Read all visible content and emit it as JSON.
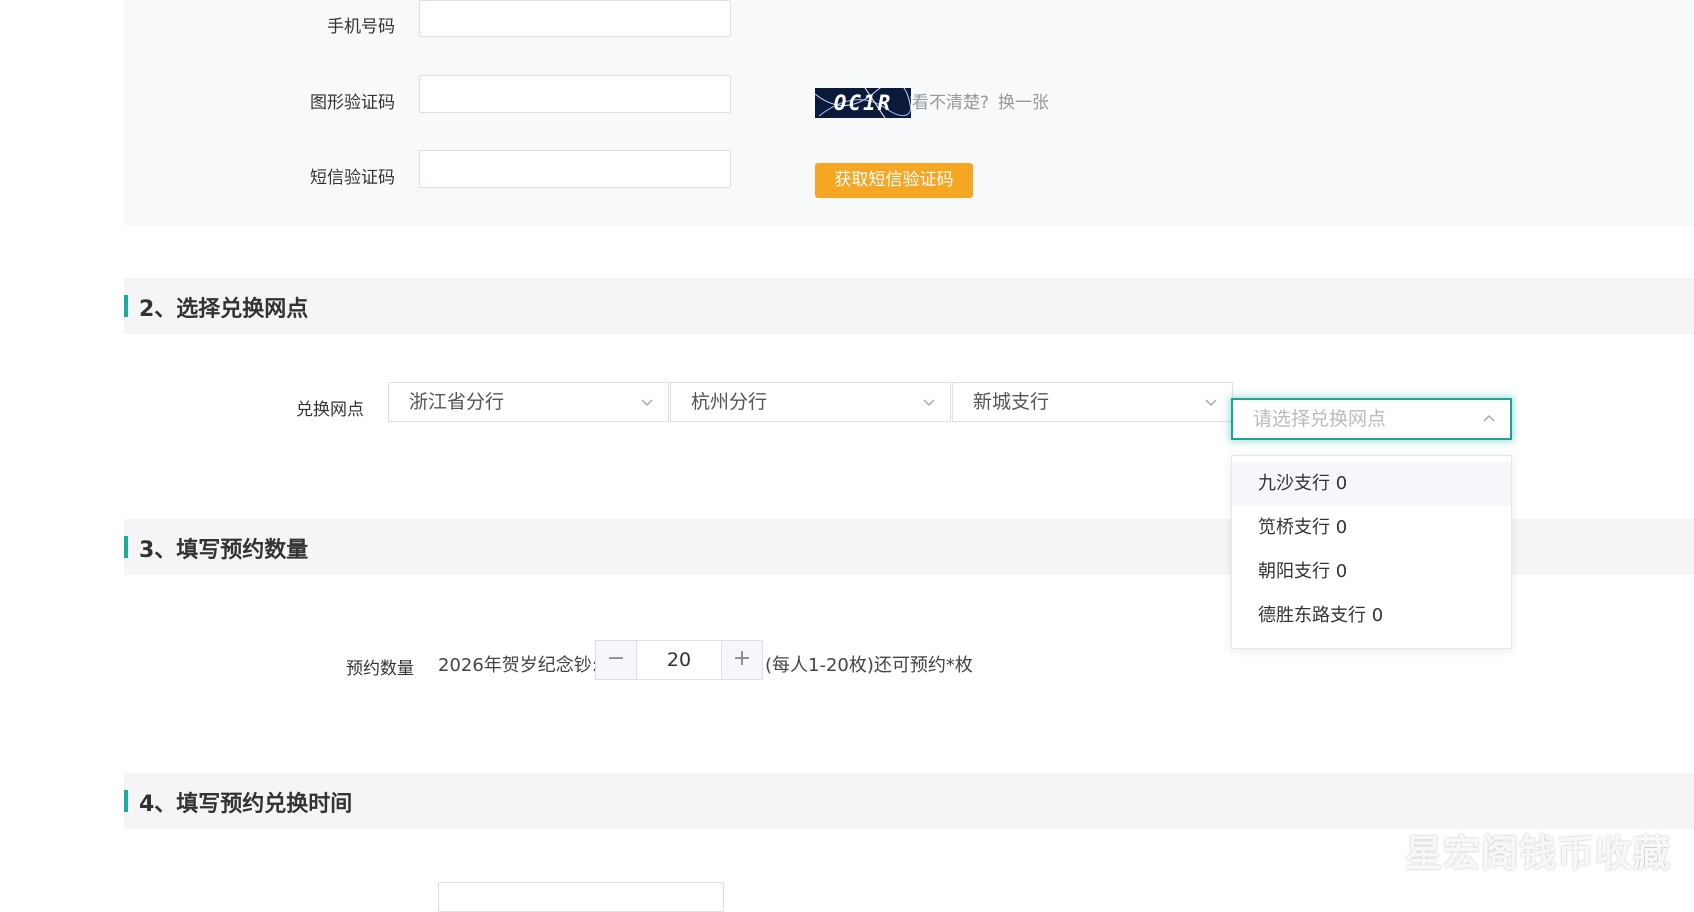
{
  "form": {
    "phone_label": "手机号码",
    "phone_value": "",
    "captcha_label": "图形验证码",
    "captcha_value": "",
    "captcha_image_text": "OC1R",
    "captcha_hint": "看不清楚?",
    "captcha_refresh": "换一张",
    "sms_label": "短信验证码",
    "sms_value": "",
    "sms_button": "获取短信验证码"
  },
  "sections": {
    "branch_title": "2、选择兑换网点",
    "quantity_title": "3、填写预约数量",
    "time_title": "4、填写预约兑换时间"
  },
  "branch": {
    "label": "兑换网点",
    "select1": "浙江省分行",
    "select2": "杭州分行",
    "select3": "新城支行",
    "select4_placeholder": "请选择兑换网点",
    "options": [
      "九沙支行 0",
      "笕桥支行 0",
      "朝阳支行 0",
      "德胜东路支行 0"
    ]
  },
  "quantity": {
    "label": "预约数量",
    "prefix": "2026年贺岁纪念钞:",
    "minus": "−",
    "value": "20",
    "plus": "+",
    "note": "(每人1-20枚)还可预约*枚"
  },
  "watermark": "星宏阁钱币收藏",
  "colors": {
    "accent": "#1aad9e",
    "button": "#f5a623",
    "panel_bg": "#f8f9fb"
  }
}
